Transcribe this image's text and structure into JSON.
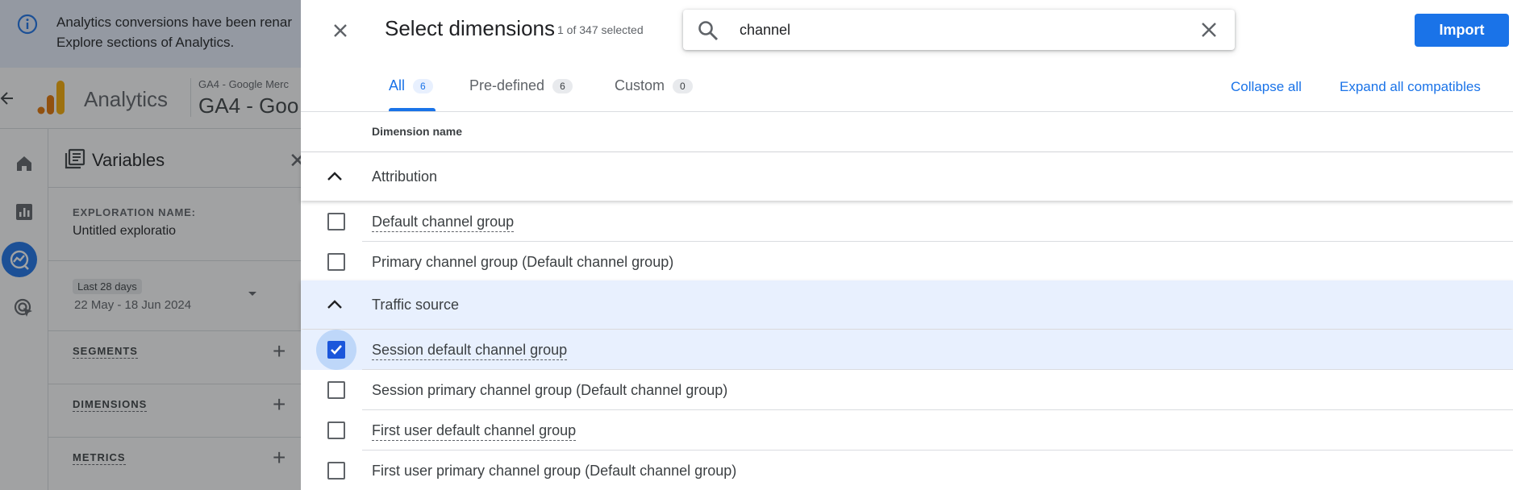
{
  "banner": {
    "line1": "Analytics conversions have been renar",
    "line2": "Explore sections of Analytics."
  },
  "header": {
    "app_name": "Analytics",
    "property_small": "GA4 - Google Merc",
    "property_big": "GA4 - Goo"
  },
  "left_nav": {
    "items": [
      "home-icon",
      "reports-icon",
      "explore-icon",
      "advertising-icon"
    ],
    "active": "explore-icon"
  },
  "variables": {
    "title": "Variables",
    "exploration_label": "EXPLORATION NAME:",
    "exploration_value": "Untitled exploratio",
    "date_chip": "Last 28 days",
    "date_range": "22 May - 18 Jun 2024",
    "segments": "SEGMENTS",
    "dimensions": "DIMENSIONS",
    "metrics": "METRICS"
  },
  "dialog": {
    "title": "Select dimensions",
    "selected_count": "1 of 347 selected",
    "search": {
      "value": "channel",
      "placeholder": ""
    },
    "import_label": "Import",
    "tabs": [
      {
        "label": "All",
        "count": "6"
      },
      {
        "label": "Pre-defined",
        "count": "6"
      },
      {
        "label": "Custom",
        "count": "0"
      }
    ],
    "active_tab": "All",
    "collapse_all": "Collapse all",
    "expand_all": "Expand all compatibles",
    "column_header": "Dimension name",
    "groups": [
      {
        "name": "Attribution",
        "items": [
          {
            "label": "Default channel group",
            "checked": false
          },
          {
            "label": "Primary channel group (Default channel group)",
            "checked": false
          }
        ]
      },
      {
        "name": "Traffic source",
        "items": [
          {
            "label": "Session default channel group",
            "checked": true
          },
          {
            "label": "Session primary channel group (Default channel group)",
            "checked": false
          },
          {
            "label": "First user default channel group",
            "checked": false
          },
          {
            "label": "First user primary channel group (Default channel group)",
            "checked": false
          }
        ]
      }
    ]
  },
  "colors": {
    "accent": "#1a73e8",
    "checkbox_checked": "#1a56db",
    "selected_row": "#e8f0fe",
    "scrim": "#202124"
  }
}
